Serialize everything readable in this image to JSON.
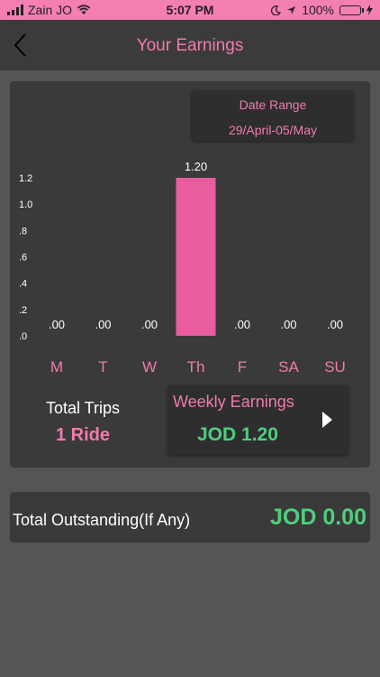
{
  "status_bar": {
    "carrier": "Zain JO",
    "time": "5:07 PM",
    "battery": "100%"
  },
  "nav": {
    "title": "Your Earnings"
  },
  "date_range": {
    "label": "Date Range",
    "value": "29/April-05/May"
  },
  "chart_data": {
    "type": "bar",
    "categories": [
      "M",
      "T",
      "W",
      "Th",
      "F",
      "SA",
      "SU"
    ],
    "values": [
      0,
      0,
      0,
      1.2,
      0,
      0,
      0
    ],
    "value_labels": [
      ".00",
      ".00",
      ".00",
      "1.20",
      ".00",
      ".00",
      ".00"
    ],
    "yticks": [
      ".0",
      ".2",
      ".4",
      ".6",
      ".8",
      "1.0",
      "1.2"
    ],
    "ylim": [
      0,
      1.2
    ],
    "grid": false,
    "bar_color": "#e95c9d",
    "label_color": "#f27aad"
  },
  "summary": {
    "trips_label": "Total Trips",
    "trips_value": "1 Ride",
    "weekly_label": "Weekly Earnings",
    "weekly_value": "JOD 1.20"
  },
  "outstanding": {
    "label": "Total Outstanding(If Any)",
    "value": "JOD 0.00"
  },
  "colors": {
    "accent": "#f27aad",
    "positive": "#4fcf7e",
    "status_bar": "#f47fb1"
  },
  "icons": {
    "back": "chevron-left-icon",
    "next": "play-arrow-icon"
  }
}
